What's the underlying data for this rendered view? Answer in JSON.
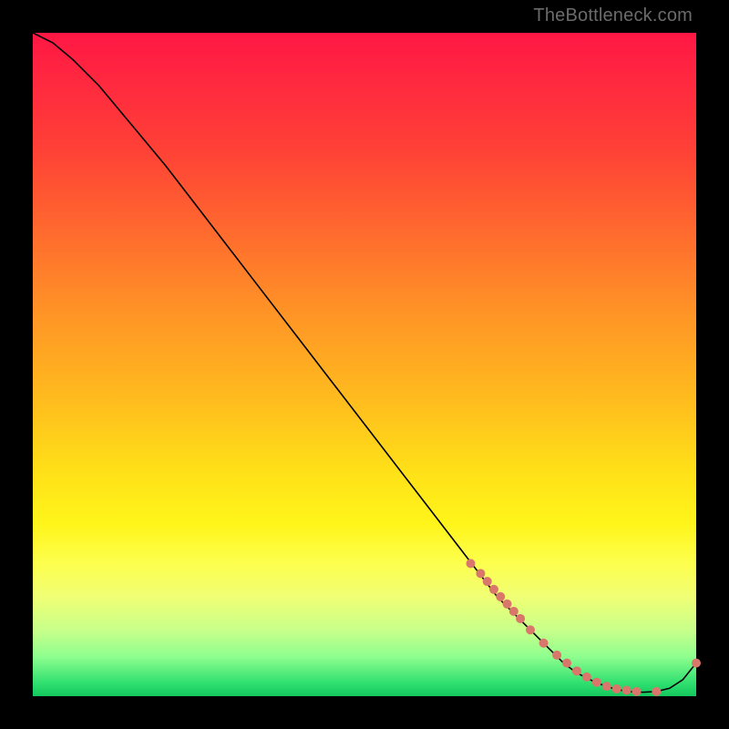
{
  "watermark": "TheBottleneck.com",
  "colors": {
    "dot": "#d9776b",
    "line": "#000000"
  },
  "chart_data": {
    "type": "line",
    "title": "",
    "xlabel": "",
    "ylabel": "",
    "xlim": [
      0,
      100
    ],
    "ylim": [
      0,
      100
    ],
    "note": "Axes unlabeled; background gradient red(top, high bottleneck)->green(bottom, low). Curve starts at top-left (100% bottleneck) and descends nearly linearly to a flat minimum near x≈82–96, then ticks up slightly at x≈100.",
    "series": [
      {
        "name": "bottleneck-curve",
        "x": [
          0,
          3,
          6,
          10,
          15,
          20,
          25,
          30,
          35,
          40,
          45,
          50,
          55,
          60,
          65,
          70,
          73,
          75,
          78,
          80,
          82,
          85,
          88,
          90,
          92,
          94,
          96,
          98,
          100
        ],
        "y": [
          100,
          98.5,
          96,
          92,
          86,
          80,
          73.5,
          67,
          60.5,
          54,
          47.5,
          41,
          34.5,
          28,
          21.5,
          15,
          12,
          10,
          7,
          5,
          3.5,
          2,
          1,
          0.7,
          0.6,
          0.7,
          1.2,
          2.5,
          5
        ]
      }
    ],
    "highlight_points": {
      "name": "sample-dots",
      "x": [
        66,
        67.5,
        68.5,
        69.5,
        70.5,
        71.5,
        72.5,
        73.5,
        75,
        77,
        79,
        80.5,
        82,
        83.5,
        85,
        86.5,
        88,
        89.5,
        91,
        94,
        100
      ],
      "y": [
        20,
        18.5,
        17.3,
        16.1,
        15,
        13.9,
        12.8,
        11.7,
        10,
        8,
        6.2,
        5,
        3.8,
        2.9,
        2.1,
        1.5,
        1.1,
        0.9,
        0.7,
        0.7,
        5
      ]
    }
  }
}
